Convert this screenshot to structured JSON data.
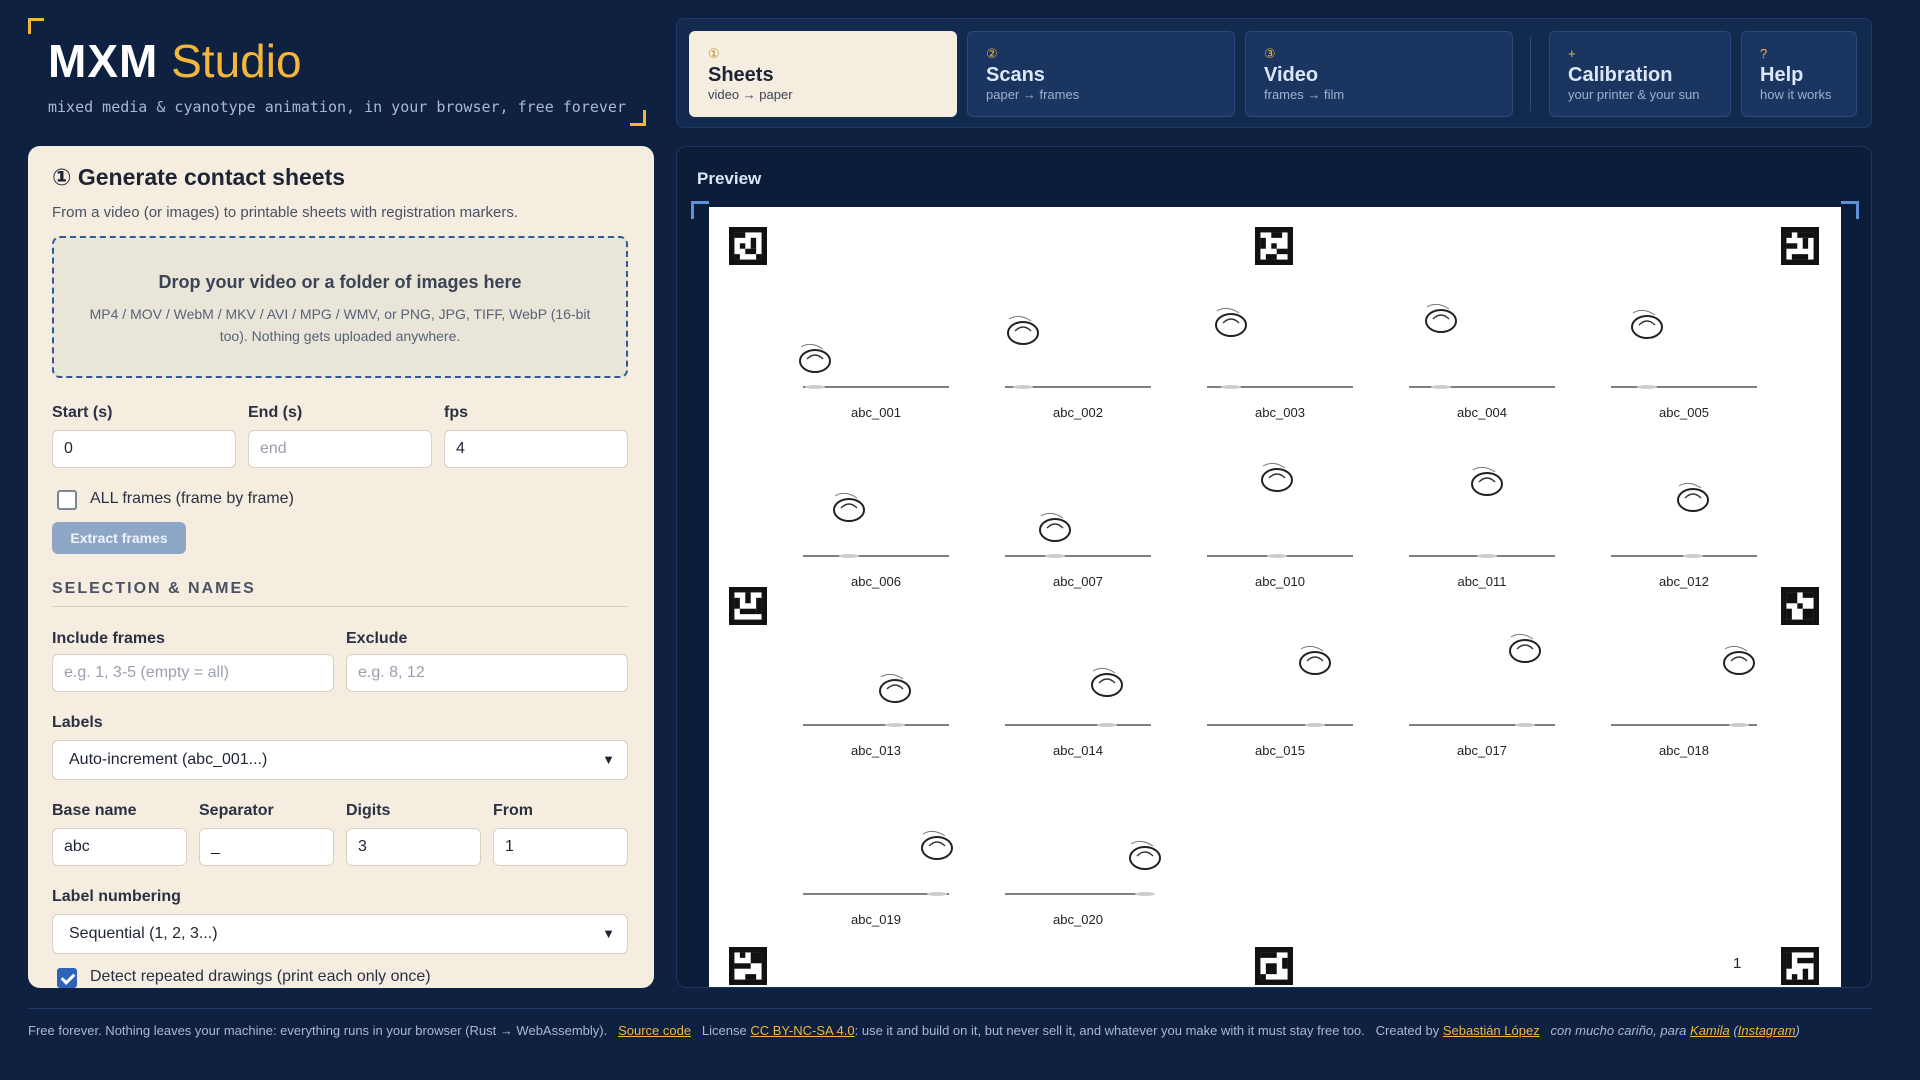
{
  "brand": {
    "name": "MXM",
    "studio": "Studio",
    "tagline": "mixed media & cyanotype animation, in your browser, free forever"
  },
  "steps": [
    {
      "num": "①",
      "name": "Sheets",
      "sub": "video → paper",
      "active": true
    },
    {
      "num": "②",
      "name": "Scans",
      "sub": "paper → frames",
      "active": false
    },
    {
      "num": "③",
      "name": "Video",
      "sub": "frames → film",
      "active": false
    },
    {
      "num": "+",
      "name": "Calibration",
      "sub": "your printer & your sun",
      "active": false
    },
    {
      "num": "?",
      "name": "Help",
      "sub": "how it works",
      "active": false
    }
  ],
  "panel": {
    "title": "① Generate contact sheets",
    "description": "From a video (or images) to printable sheets with registration markers.",
    "drop_title": "Drop your video or a folder of images here",
    "drop_text": "MP4 / MOV / WebM / MKV / AVI / MPG / WMV, or PNG, JPG, TIFF, WebP (16-bit too). Nothing gets uploaded anywhere.",
    "start_label": "Start (s)",
    "start_value": "0",
    "end_label": "End (s)",
    "end_placeholder": "end",
    "fps_label": "fps",
    "fps_value": "4",
    "all_frames_label": "ALL frames (frame by frame)",
    "all_frames_checked": false,
    "extract_button": "Extract frames",
    "section_title": "SELECTION & NAMES",
    "include_label": "Include frames",
    "include_placeholder": "e.g. 1, 3-5 (empty = all)",
    "exclude_label": "Exclude",
    "exclude_placeholder": "e.g. 8, 12",
    "labels_label": "Labels",
    "labels_value": "Auto-increment (abc_001...)",
    "base_name_label": "Base name",
    "base_name_value": "abc",
    "separator_label": "Separator",
    "separator_value": "_",
    "digits_label": "Digits",
    "digits_value": "3",
    "from_label": "From",
    "from_value": "1",
    "label_numbering_label": "Label numbering",
    "label_numbering_value": "Sequential (1, 2, 3...)",
    "detect_label": "Detect repeated drawings (print each only once)",
    "detect_checked": true
  },
  "preview": {
    "title": "Preview",
    "page_number": "1",
    "frames": [
      "abc_001",
      "abc_002",
      "abc_003",
      "abc_004",
      "abc_005",
      "abc_006",
      "abc_007",
      "abc_010",
      "abc_011",
      "abc_012",
      "abc_013",
      "abc_014",
      "abc_015",
      "abc_017",
      "abc_018",
      "abc_019",
      "abc_020"
    ]
  },
  "footer": {
    "text1": "Free forever. Nothing leaves your machine: everything runs in your browser (Rust → WebAssembly).",
    "source_link": "Source code",
    "license_text": "License",
    "license_link": "CC BY-NC-SA 4.0",
    "text2": ": use it and build on it, but never sell it, and whatever you make with it must stay free too.",
    "created_text": "Created by",
    "author_link": "Sebastián López",
    "dedication": "con mucho cariño, para",
    "kamila_link": "Kamila",
    "instagram_link": "Instagram"
  },
  "colors": {
    "background": "#0f2140",
    "accent": "#f3b63a",
    "panel": "#f4ede0",
    "primary_blue": "#2e63b8"
  }
}
